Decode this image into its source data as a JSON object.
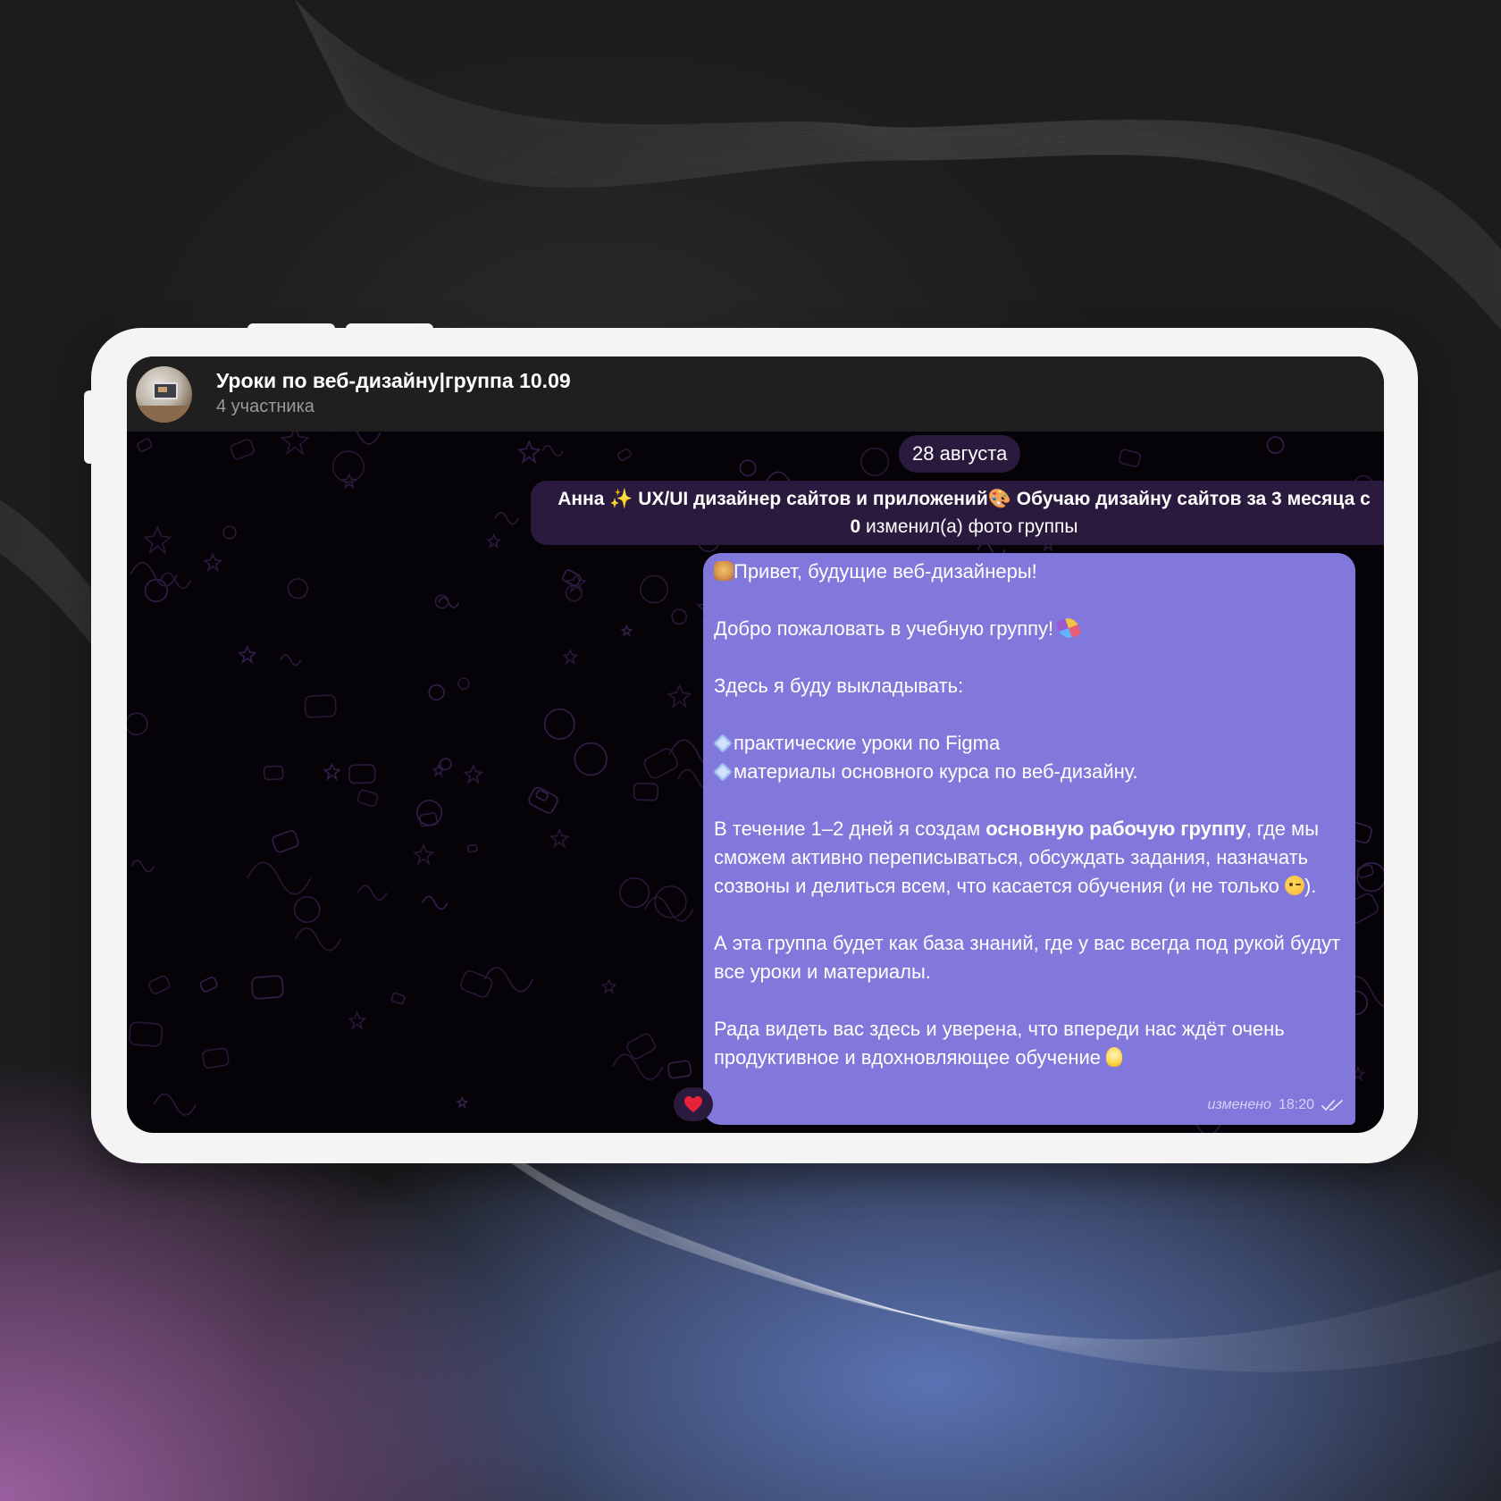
{
  "chat": {
    "title": "Уроки по веб-дизайну|группа 10.09",
    "subtitle": "4 участника"
  },
  "date_separator": "28 августа",
  "service_message": {
    "line1": "Анна ✨ UX/UI дизайнер сайтов и приложений🎨 Обучаю дизайну сайтов за 3 месяца с",
    "line2_name": "0",
    "line2_action": " изменил(а) фото группы"
  },
  "message": {
    "greeting": "Привет, будущие веб-дизайнеры!",
    "welcome": "Добро пожаловать в учебную группу!",
    "intro": "Здесь я буду выкладывать:",
    "bullet1": "практические уроки по Figma",
    "bullet2": "материалы основного курса по веб-дизайну.",
    "p4_before": "В течение 1–2 дней я создам ",
    "p4_bold": "основную рабочую группу",
    "p4_after": ", где мы сможем активно переписываться, обсуждать задания, назначать созвоны и делиться всем, что касается обучения (и не только",
    "p4_end": ").",
    "p5": "А эта группа будет как база знаний, где у вас всегда под рукой будут все уроки и материалы.",
    "p6": "Рада видеть вас здесь и уверена, что впереди нас ждёт очень продуктивное и вдохновляющее обучение",
    "edited_label": "изменено",
    "time": "18:20",
    "status": "read"
  },
  "reaction": {
    "emoji": "heart",
    "color": "#e8223a"
  },
  "colors": {
    "bubble": "#8278dc",
    "service_bg": "#2a1b3e",
    "header_bg": "#1f1f20",
    "chat_bg": "#050307"
  },
  "icons": [
    "avatar-photo",
    "double-check-icon",
    "heart-icon",
    "sparkles-emoji",
    "palette-emoji",
    "party-popper-emoji",
    "diamond-emoji",
    "wink-emoji",
    "lightbulb-emoji"
  ]
}
